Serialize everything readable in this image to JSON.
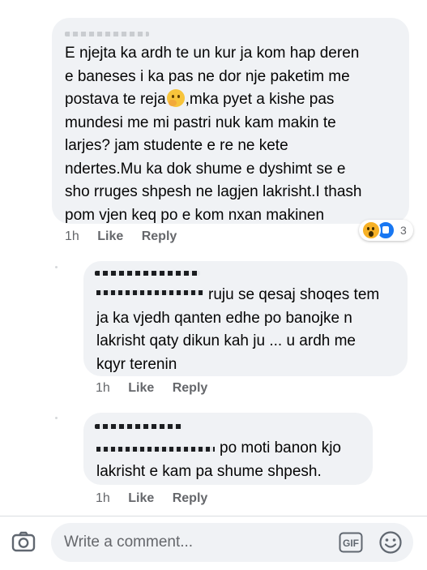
{
  "comments": [
    {
      "text_lines": [
        "E njejta ka ardh te un kur ja kom hap deren",
        "e baneses i ka pas ne dor nje paketim me",
        "postava te reja",
        ",mka pyet a kishe pas",
        "mundesi me mi pastri nuk kam makin te",
        "larjes? jam studente e re ne kete",
        "ndertes.Mu  ka dok shume e dyshimt se e",
        "sho rruges shpesh ne lagjen lakrisht.I thash",
        "pom vjen keq po e kom nxan makinen"
      ],
      "time": "1h",
      "like": "Like",
      "reply": "Reply",
      "reaction_count": "3"
    },
    {
      "text_lines": [
        "ruju se qesaj shoqes tem",
        "ja ka vjedh qanten edhe po banojke n",
        "lakrisht qaty dikun kah ju ... u ardh me",
        "kqyr terenin"
      ],
      "time": "1h",
      "like": "Like",
      "reply": "Reply"
    },
    {
      "text_lines": [
        "po moti banon kjo",
        "lakrisht e kam pa shume shpesh."
      ],
      "time": "1h",
      "like": "Like",
      "reply": "Reply"
    }
  ],
  "icons": {
    "emoji_inline": "thinking-face-icon",
    "reactions": [
      "wow-reaction-icon",
      "like-reaction-icon"
    ]
  },
  "composer": {
    "placeholder": "Write a comment...",
    "gif_label": "GIF"
  },
  "colors": {
    "bubble": "#f0f2f5",
    "meta_text": "#65676b",
    "like_blue": "#1877f2"
  }
}
